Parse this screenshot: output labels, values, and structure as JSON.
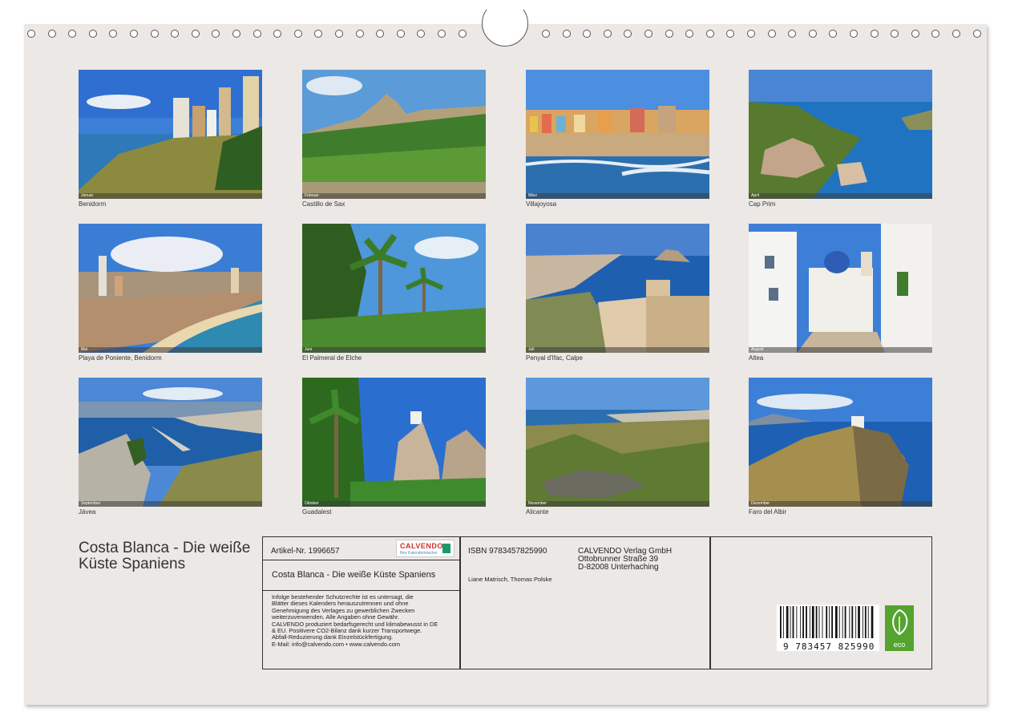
{
  "photos": [
    {
      "caption": "Benidorm",
      "month": "Januar"
    },
    {
      "caption": "Castillo de Sax",
      "month": "Februar"
    },
    {
      "caption": "Villajoyosa",
      "month": "März"
    },
    {
      "caption": "Cap Prim",
      "month": "April"
    },
    {
      "caption": "Playa de Poniente, Benidorm",
      "month": "Mai"
    },
    {
      "caption": "El Palmeral de Elche",
      "month": "Juni"
    },
    {
      "caption": "Penyal d'Ifac, Calpe",
      "month": "Juli"
    },
    {
      "caption": "Altea",
      "month": "August"
    },
    {
      "caption": "Jávea",
      "month": "September"
    },
    {
      "caption": "Guadalest",
      "month": "Oktober"
    },
    {
      "caption": "Alicante",
      "month": "November"
    },
    {
      "caption": "Faro del Albir",
      "month": "Dezember"
    }
  ],
  "calendar": {
    "title": "Costa Blanca - Die weiße Küste Spaniens"
  },
  "info": {
    "article": "Artikel-Nr. 1996657",
    "title_line": "Costa Blanca - Die weiße Küste Spaniens",
    "legal": [
      "Infolge bestehender Schutzrechte ist es untersagt, die",
      "Blätter dieses Kalenders herauszutrennen und ohne",
      "Genehmigung des Verlages zu gewerblichen Zwecken",
      "weiterzuverwenden. Alle Angaben ohne Gewähr.",
      "CALVENDO produziert bedarfsgerecht und klimabewusst in DE",
      "& EU. Positivere CO2-Bilanz dank kurzer Transportwege.",
      "Abfall-Reduzierung dank Einzelstückfertigung.",
      "E-Mail: info@calvendo.com • www.calvendo.com"
    ],
    "isbn": "ISBN 9783457825990",
    "authors": "Liane Matrisch, Thomas Polske",
    "publisher": [
      "CALVENDO Verlag GmbH",
      "Ottobrunner Straße 39",
      "D-82008 Unterhaching"
    ],
    "logo_name": "CALVENDO",
    "logo_sub": "Ihre Kalendermacher",
    "barcode_number": "9 783457 825990",
    "eco_label": "eco"
  }
}
